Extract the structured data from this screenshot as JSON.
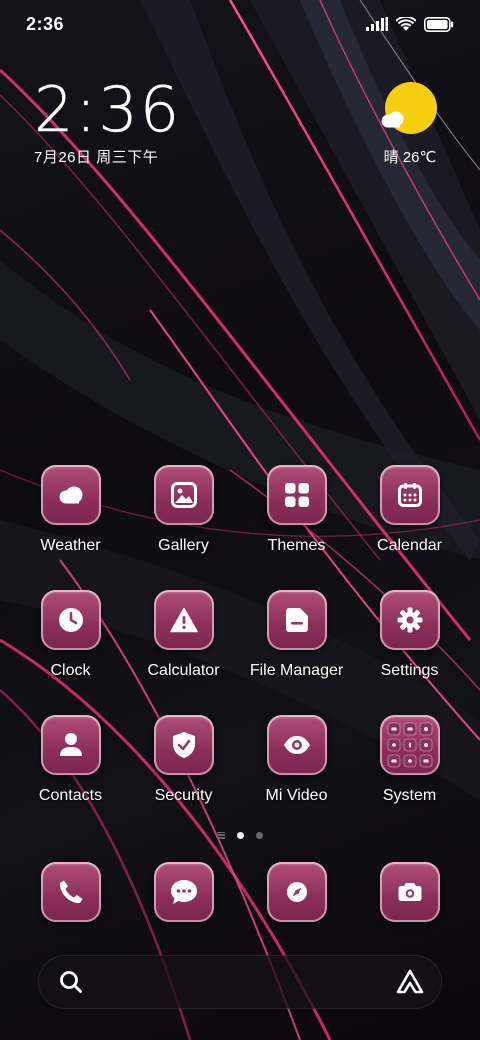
{
  "status_bar": {
    "time": "2:36",
    "signal_icon": "signal-bars-icon",
    "wifi_icon": "wifi-icon",
    "battery_icon": "battery-icon"
  },
  "clock_widget": {
    "time": "2:36",
    "date": "7月26日 周三下午"
  },
  "weather_widget": {
    "icon": "sun-cloud-icon",
    "text": "晴 26℃",
    "sun_color": "#f6ce10"
  },
  "apps": [
    {
      "label": "Weather",
      "icon": "weather-icon"
    },
    {
      "label": "Gallery",
      "icon": "gallery-icon"
    },
    {
      "label": "Themes",
      "icon": "themes-icon"
    },
    {
      "label": "Calendar",
      "icon": "calendar-icon"
    },
    {
      "label": "Clock",
      "icon": "clock-icon"
    },
    {
      "label": "Calculator",
      "icon": "calculator-icon"
    },
    {
      "label": "File Manager",
      "icon": "file-manager-icon"
    },
    {
      "label": "Settings",
      "icon": "settings-icon"
    },
    {
      "label": "Contacts",
      "icon": "contacts-icon"
    },
    {
      "label": "Security",
      "icon": "security-icon"
    },
    {
      "label": "Mi Video",
      "icon": "mi-video-icon"
    },
    {
      "label": "System",
      "icon": "system-folder-icon"
    }
  ],
  "page_indicator": {
    "pages": 2,
    "active": 1
  },
  "dock": [
    {
      "icon": "phone-icon"
    },
    {
      "icon": "messages-icon"
    },
    {
      "icon": "browser-icon"
    },
    {
      "icon": "camera-icon"
    }
  ],
  "search_bar": {
    "search_icon": "search-icon",
    "assistant_icon": "assistant-icon"
  },
  "colors": {
    "icon_gradient_top": "#b04e7a",
    "icon_gradient_bottom": "#7a2550",
    "wallpaper_accent": "#d0306e"
  }
}
